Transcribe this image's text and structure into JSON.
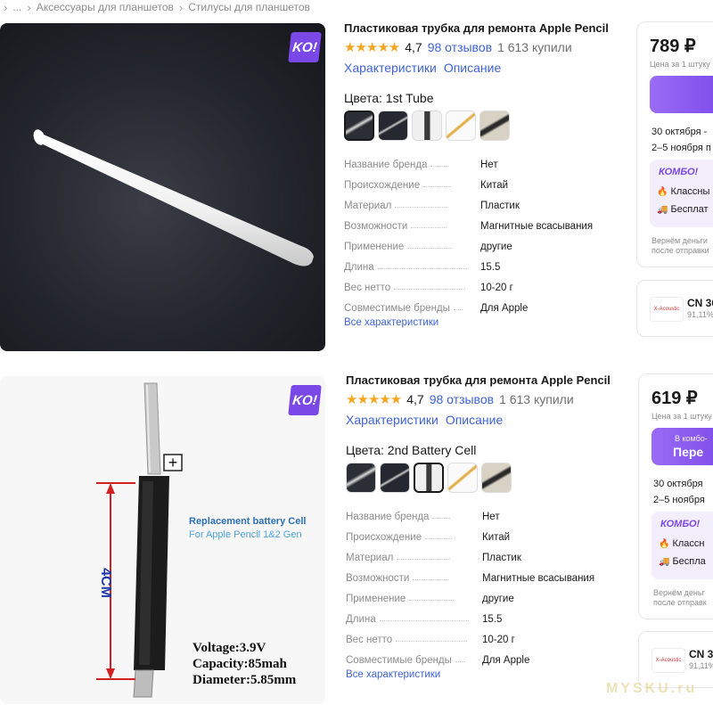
{
  "breadcrumbs": {
    "chevron": "›",
    "items": [
      "...",
      "Аксессуары для планшетов",
      "Стилусы для планшетов"
    ]
  },
  "badge": "KO!",
  "cards": [
    {
      "title": "Пластиковая трубка для ремонта Apple Pencil",
      "stars": "★★★★★",
      "rating": "4,7",
      "reviews": "98 отзывов",
      "bought": "1 613 купили",
      "tabs": [
        "Характеристики",
        "Описание"
      ],
      "colors_label": "Цвета: 1st Tube",
      "selected_swatch": 0,
      "specs": [
        {
          "k": "Название бренда",
          "v": "Нет"
        },
        {
          "k": "Происхождение",
          "v": "Китай"
        },
        {
          "k": "Материал",
          "v": "Пластик"
        },
        {
          "k": "Возможности",
          "v": "Магнитные всасывания"
        },
        {
          "k": "Применение",
          "v": "другие"
        },
        {
          "k": "Длина",
          "v": "15.5"
        },
        {
          "k": "Вес нетто",
          "v": "10-20 г"
        },
        {
          "k": "Совместимые бренды",
          "v": "Для Apple"
        }
      ],
      "all_chars": "Все характеристики",
      "price": "789 ₽",
      "per_unit": "Цена за 1 штуку",
      "buy_line1": "",
      "buy_line2": "",
      "delivery1": "30 октября -",
      "delivery2": "2–5 ноября п",
      "combo_logo": "КОМБО!",
      "combo_item1": "Классны",
      "combo_item2": "Бесплат",
      "refund1": "Вернём деньги",
      "refund2": "после отправки",
      "seller_logo": "X-Acoustic",
      "seller_name": "CN 36",
      "seller_rate": "91,11%"
    },
    {
      "title": "Пластиковая трубка для ремонта Apple Pencil",
      "stars": "★★★★★",
      "rating": "4,7",
      "reviews": "98 отзывов",
      "bought": "1 613 купили",
      "tabs": [
        "Характеристики",
        "Описание"
      ],
      "colors_label": "Цвета: 2nd Battery Cell",
      "selected_swatch": 2,
      "specs": [
        {
          "k": "Название бренда",
          "v": "Нет"
        },
        {
          "k": "Происхождение",
          "v": "Китай"
        },
        {
          "k": "Материал",
          "v": "Пластик"
        },
        {
          "k": "Возможности",
          "v": "Магнитные всасывания"
        },
        {
          "k": "Применение",
          "v": "другие"
        },
        {
          "k": "Длина",
          "v": "15.5"
        },
        {
          "k": "Вес нетто",
          "v": "10-20 г"
        },
        {
          "k": "Совместимые бренды",
          "v": "Для Apple"
        }
      ],
      "all_chars": "Все характеристики",
      "price": "619 ₽",
      "per_unit": "Цена за 1 штуку",
      "buy_line1": "В комбо-",
      "buy_line2": "Пере",
      "delivery1": "30 октября",
      "delivery2": "2–5 ноября",
      "combo_logo": "КОМБО!",
      "combo_item1": "Классн",
      "combo_item2": "Беспла",
      "refund1": "Вернём деньг",
      "refund2": "после отправк",
      "seller_logo": "X-Acoustic",
      "seller_name": "CN 3",
      "seller_rate": "91,11%"
    }
  ],
  "battery_image": {
    "plus": "+",
    "dimension": "4CM",
    "caption1": "Replacement battery Cell",
    "caption2": "For Apple Pencil 1&2 Gen",
    "voltage": "Voltage:3.9V",
    "capacity": "Capacity:85mah",
    "diameter": "Diameter:5.85mm"
  },
  "watermark": "MYSKU.ru"
}
